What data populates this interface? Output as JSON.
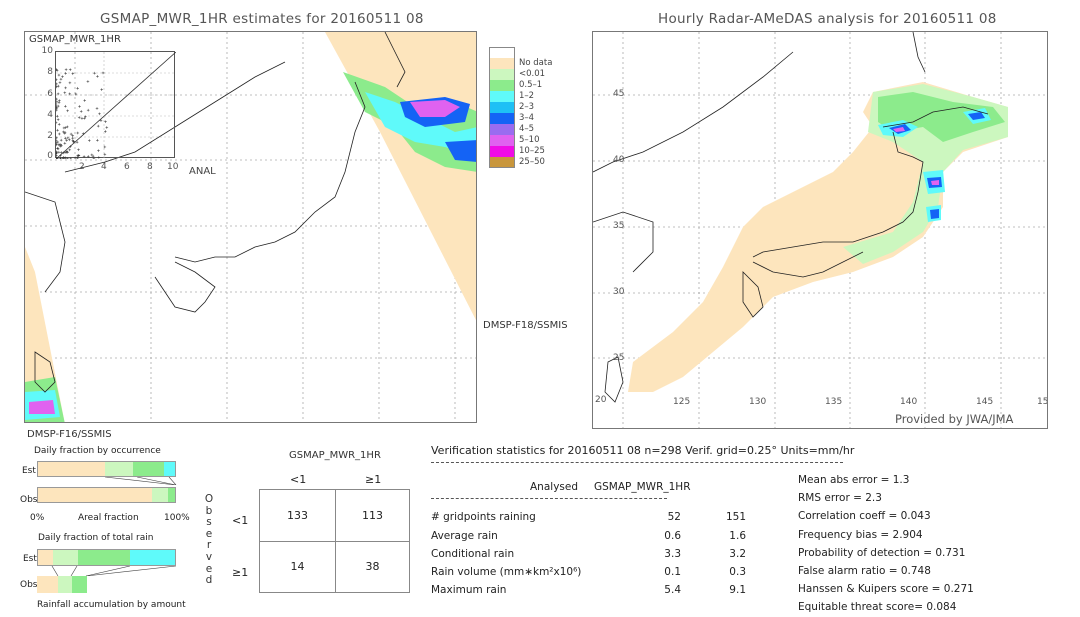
{
  "left_panel": {
    "title": "GSMAP_MWR_1HR estimates for 20160511 08",
    "scatter": {
      "ylabel": "GSMAP_MWR_1HR",
      "xlabel": "ANAL",
      "y_ticks": [
        "10",
        "8",
        "6",
        "4",
        "2",
        "0"
      ],
      "x_ticks": [
        "2",
        "4",
        "6",
        "8",
        "10"
      ]
    },
    "satellite_right": "DMSP-F18/SSMIS",
    "satellite_bottom": "DMSP-F16/SSMIS"
  },
  "legend": {
    "items": [
      {
        "label": "",
        "color": "#ffffff"
      },
      {
        "label": "No data",
        "color": "#fde5bd"
      },
      {
        "label": "<0.01",
        "color": "#ccf7bf"
      },
      {
        "label": "0.5–1",
        "color": "#8ceb8c"
      },
      {
        "label": "1–2",
        "color": "#5ffafa"
      },
      {
        "label": "2–3",
        "color": "#1ec0f5"
      },
      {
        "label": "3–4",
        "color": "#1463f5"
      },
      {
        "label": "4–5",
        "color": "#9a6cf0"
      },
      {
        "label": "5–10",
        "color": "#e062f0"
      },
      {
        "label": "10–25",
        "color": "#f00ce6"
      },
      {
        "label": "25–50",
        "color": "#c8963c"
      }
    ]
  },
  "right_panel": {
    "title": "Hourly Radar-AMeDAS analysis for 20160511 08",
    "lat_labels": [
      "45",
      "40",
      "35",
      "30",
      "25",
      "20"
    ],
    "lon_labels": [
      "125",
      "130",
      "135",
      "140",
      "145",
      "15"
    ],
    "credit": "Provided by JWA/JMA"
  },
  "fraction_charts": {
    "occurrence_title": "Daily fraction by occurrence",
    "est_label": "Est",
    "obs_label": "Obs",
    "axis_left": "0%",
    "axis_mid": "Areal fraction",
    "axis_right": "100%",
    "occurrence_est": [
      {
        "fraction": 0.49,
        "color": "#fde5bd"
      },
      {
        "fraction": 0.2,
        "color": "#ccf7bf"
      },
      {
        "fraction": 0.23,
        "color": "#8ceb8c"
      },
      {
        "fraction": 0.08,
        "color": "#5ffafa"
      }
    ],
    "occurrence_obs": [
      {
        "fraction": 0.83,
        "color": "#fde5bd"
      },
      {
        "fraction": 0.12,
        "color": "#ccf7bf"
      },
      {
        "fraction": 0.05,
        "color": "#8ceb8c"
      }
    ],
    "total_title": "Daily fraction of total rain",
    "total_est": [
      {
        "fraction": 0.11,
        "color": "#fde5bd"
      },
      {
        "fraction": 0.18,
        "color": "#ccf7bf"
      },
      {
        "fraction": 0.38,
        "color": "#8ceb8c"
      },
      {
        "fraction": 0.33,
        "color": "#5ffafa"
      }
    ],
    "total_obs": [
      {
        "fraction": 0.15,
        "color": "#fde5bd"
      },
      {
        "fraction": 0.1,
        "color": "#ccf7bf"
      },
      {
        "fraction": 0.11,
        "color": "#8ceb8c"
      }
    ],
    "accumulation_title": "Rainfall accumulation by amount"
  },
  "contingency": {
    "model_label": "GSMAP_MWR_1HR",
    "col_headers": [
      "<1",
      "≥1"
    ],
    "row_headers": [
      "<1",
      "≥1"
    ],
    "observed_letters": [
      "O",
      "b",
      "s",
      "e",
      "r",
      "v",
      "e",
      "d"
    ],
    "cells": [
      [
        "133",
        "113"
      ],
      [
        "14",
        "38"
      ]
    ]
  },
  "verification": {
    "header": "Verification statistics for 20160511 08   n=298   Verif. grid=0.25°   Units=mm/hr",
    "col_analysed": "Analysed",
    "col_model": "GSMAP_MWR_1HR",
    "rows": [
      {
        "label": "# gridpoints raining",
        "analysed": "52",
        "model": "151"
      },
      {
        "label": "Average rain",
        "analysed": "0.6",
        "model": "1.6"
      },
      {
        "label": "Conditional rain",
        "analysed": "3.3",
        "model": "3.2"
      },
      {
        "label": "Rain volume (mm∗km²x10⁶)",
        "analysed": "0.1",
        "model": "0.3"
      },
      {
        "label": "Maximum rain",
        "analysed": "5.4",
        "model": "9.1"
      }
    ],
    "scores": [
      "Mean abs error = 1.3",
      "RMS error = 2.3",
      "Correlation coeff = 0.043",
      "Frequency bias = 2.904",
      "Probability of detection = 0.731",
      "False alarm ratio = 0.748",
      "Hanssen & Kuipers score = 0.271",
      "Equitable threat score= 0.084"
    ]
  }
}
